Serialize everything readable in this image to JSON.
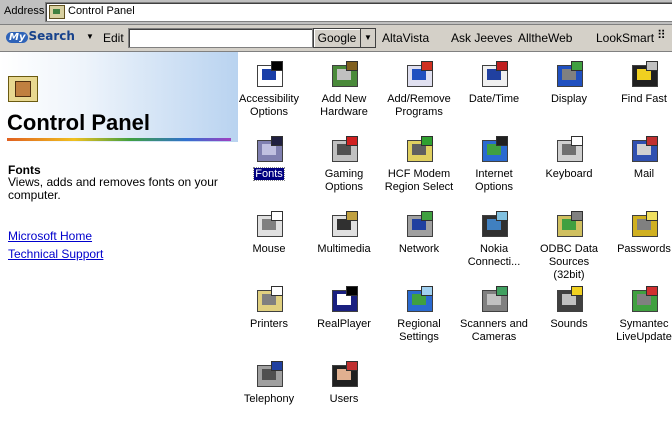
{
  "address": {
    "label": "Address",
    "value": "Control Panel"
  },
  "toolbar": {
    "logo_my": "My",
    "logo_search": "Search",
    "edit_label": "Edit",
    "search_value": "",
    "engine_button": "Google",
    "links": [
      "AltaVista",
      "Ask Jeeves",
      "AlltheWeb",
      "LookSmart"
    ]
  },
  "left": {
    "title": "Control Panel",
    "selected_name": "Fonts",
    "selected_desc": "Views, adds and removes fonts on your computer.",
    "links": [
      "Microsoft Home",
      "Technical Support"
    ]
  },
  "icons": [
    {
      "label": "Accessibility Options",
      "icon": "accessibility-icon",
      "selected": false
    },
    {
      "label": "Add New Hardware",
      "icon": "add-hardware-icon",
      "selected": false
    },
    {
      "label": "Add/Remove Programs",
      "icon": "add-remove-programs-icon",
      "selected": false
    },
    {
      "label": "Date/Time",
      "icon": "date-time-icon",
      "selected": false
    },
    {
      "label": "Display",
      "icon": "display-icon",
      "selected": false
    },
    {
      "label": "Find Fast",
      "icon": "find-fast-icon",
      "selected": false
    },
    {
      "label": "Fonts",
      "icon": "fonts-icon",
      "selected": true
    },
    {
      "label": "Gaming Options",
      "icon": "gaming-icon",
      "selected": false
    },
    {
      "label": "HCF Modem Region Select",
      "icon": "modem-icon",
      "selected": false
    },
    {
      "label": "Internet Options",
      "icon": "internet-icon",
      "selected": false
    },
    {
      "label": "Keyboard",
      "icon": "keyboard-icon",
      "selected": false
    },
    {
      "label": "Mail",
      "icon": "mail-icon",
      "selected": false
    },
    {
      "label": "Mouse",
      "icon": "mouse-icon",
      "selected": false
    },
    {
      "label": "Multimedia",
      "icon": "multimedia-icon",
      "selected": false
    },
    {
      "label": "Network",
      "icon": "network-icon",
      "selected": false
    },
    {
      "label": "Nokia Connecti...",
      "icon": "nokia-phone-icon",
      "selected": false
    },
    {
      "label": "ODBC Data Sources (32bit)",
      "icon": "odbc-icon",
      "selected": false
    },
    {
      "label": "Passwords",
      "icon": "passwords-icon",
      "selected": false
    },
    {
      "label": "Printers",
      "icon": "printers-icon",
      "selected": false
    },
    {
      "label": "RealPlayer",
      "icon": "realplayer-icon",
      "selected": false
    },
    {
      "label": "Regional Settings",
      "icon": "regional-icon",
      "selected": false
    },
    {
      "label": "Scanners and Cameras",
      "icon": "scanner-icon",
      "selected": false
    },
    {
      "label": "Sounds",
      "icon": "sounds-icon",
      "selected": false
    },
    {
      "label": "Symantec LiveUpdate",
      "icon": "liveupdate-icon",
      "selected": false
    },
    {
      "label": "Telephony",
      "icon": "telephony-icon",
      "selected": false
    },
    {
      "label": "Users",
      "icon": "users-icon",
      "selected": false
    }
  ]
}
